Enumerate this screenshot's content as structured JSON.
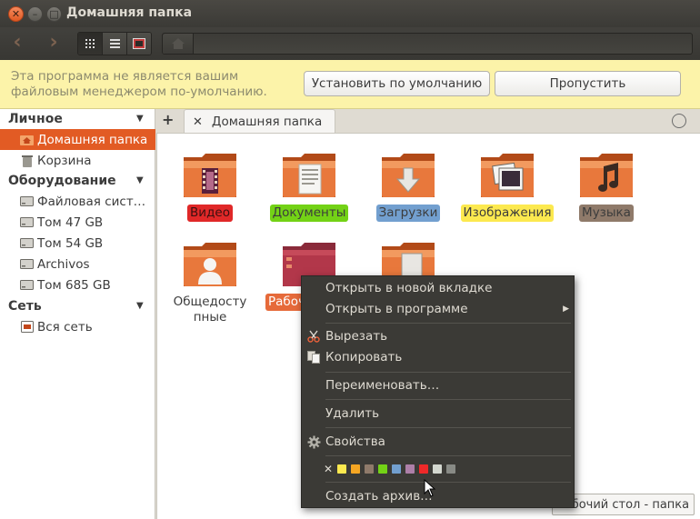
{
  "window": {
    "title": "Домашняя папка"
  },
  "infobar": {
    "message": "Эта программа не является вашим файловым менеджером по-умолчанию.",
    "set_default_label": "Установить по умолчанию",
    "skip_label": "Пропустить"
  },
  "sidebar": {
    "personal": "Личное",
    "devices": "Оборудование",
    "network": "Сеть",
    "items": {
      "home": "Домашняя папка",
      "trash": "Корзина",
      "filesystem": "Файловая сист…",
      "vol47": "Том 47 GB",
      "vol54": "Том 54 GB",
      "archivos": "Archivos",
      "vol685": "Том 685 GB",
      "allnet": "Вся сеть"
    }
  },
  "tab": {
    "label": "Домашняя папка"
  },
  "files": [
    {
      "label": "Видео",
      "tag": "#e02828"
    },
    {
      "label": "Документы",
      "tag": "#73d216"
    },
    {
      "label": "Загрузки",
      "tag": "#729fcf"
    },
    {
      "label": "Изображения",
      "tag": "#fce94f"
    },
    {
      "label": "Музыка",
      "tag": "#8f7a6a"
    },
    {
      "label": "Общедоступные",
      "tag": ""
    },
    {
      "label": "Рабоч",
      "tag": "#e66a3a"
    },
    {
      "label": "",
      "tag": ""
    }
  ],
  "menu": {
    "open_tab": "Открыть в новой вкладке",
    "open_with": "Открыть в программе",
    "cut": "Вырезать",
    "copy": "Копировать",
    "rename": "Переименовать…",
    "delete": "Удалить",
    "properties": "Свойства",
    "archive": "Создать архив…"
  },
  "colors": {
    "accent": "#e25b24",
    "swatches": [
      "#fce94f",
      "#f5a623",
      "#8f7a6a",
      "#73d216",
      "#729fcf",
      "#ad7fa8",
      "#ef2929",
      "#d3d7cf",
      "#888a85"
    ]
  },
  "status": "Рабочий стол - папка"
}
